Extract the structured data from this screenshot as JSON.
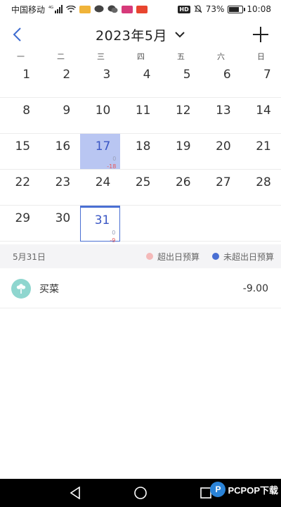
{
  "status_bar": {
    "carrier": "中国移动",
    "network": "4G",
    "battery": "73%",
    "battery_level": 0.73,
    "time": "10:08",
    "hd": "HD"
  },
  "header": {
    "title": "2023年5月"
  },
  "weekdays": [
    "一",
    "二",
    "三",
    "四",
    "五",
    "六",
    "日"
  ],
  "calendar": {
    "days": [
      {
        "day": "1"
      },
      {
        "day": "2"
      },
      {
        "day": "3"
      },
      {
        "day": "4"
      },
      {
        "day": "5"
      },
      {
        "day": "6"
      },
      {
        "day": "7"
      },
      {
        "day": "8"
      },
      {
        "day": "9"
      },
      {
        "day": "10"
      },
      {
        "day": "11"
      },
      {
        "day": "12"
      },
      {
        "day": "13"
      },
      {
        "day": "14"
      },
      {
        "day": "15"
      },
      {
        "day": "16"
      },
      {
        "day": "17",
        "budget": "0",
        "amount": "-18",
        "state": "over"
      },
      {
        "day": "18"
      },
      {
        "day": "19"
      },
      {
        "day": "20"
      },
      {
        "day": "21"
      },
      {
        "day": "22"
      },
      {
        "day": "23"
      },
      {
        "day": "24"
      },
      {
        "day": "25"
      },
      {
        "day": "26"
      },
      {
        "day": "27"
      },
      {
        "day": "28"
      },
      {
        "day": "29"
      },
      {
        "day": "30"
      },
      {
        "day": "31",
        "budget": "0",
        "amount": "-9",
        "state": "selected"
      }
    ]
  },
  "day_summary": {
    "date": "5月31日",
    "legend_over": "超出日预算",
    "legend_under": "未超出日预算"
  },
  "colors": {
    "over_dot": "#f4b9b9",
    "under_dot": "#4a6fd3",
    "record_icon_bg": "#8fd6cf"
  },
  "records": [
    {
      "name": "买菜",
      "amount": "-9.00",
      "icon": "vegetable-icon"
    }
  ],
  "watermark": {
    "text": "PCPOP下载"
  }
}
